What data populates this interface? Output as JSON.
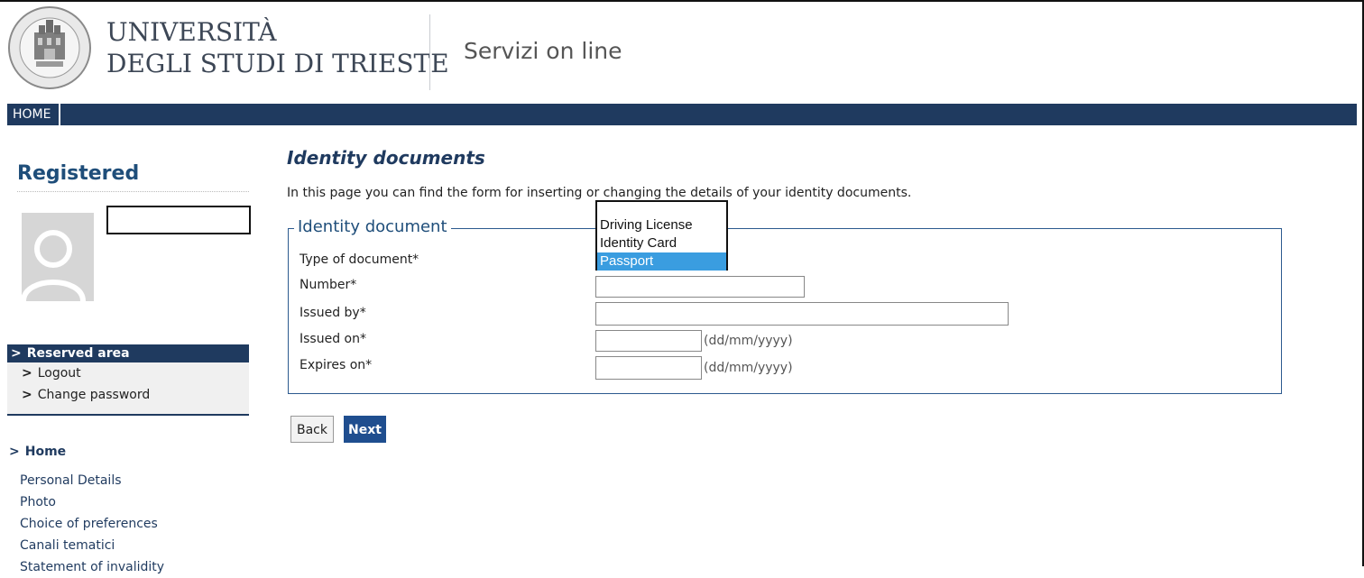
{
  "header": {
    "uni_line1": "UNIVERSITÀ",
    "uni_line2": "DEGLI STUDI DI TRIESTE",
    "services": "Servizi on line"
  },
  "nav": {
    "home": "HOME"
  },
  "sidebar": {
    "title": "Registered",
    "reserved_area": {
      "title": "Reserved area",
      "items": [
        "Logout",
        "Change password"
      ]
    },
    "home": "Home",
    "links": [
      "Personal Details",
      "Photo",
      "Choice of preferences",
      "Canali tematici",
      "Statement of invalidity"
    ]
  },
  "main": {
    "title": "Identity documents",
    "intro": "In this page you can find the form for inserting or changing the details of your identity documents.",
    "fieldset_legend": "Identity document",
    "fields": {
      "type_label": "Type of document*",
      "number_label": "Number*",
      "issued_by_label": "Issued by*",
      "issued_on_label": "Issued on*",
      "expires_on_label": "Expires on*",
      "date_format": "(dd/mm/yyyy)"
    },
    "dropdown_options": [
      "Driving License",
      "Identity Card",
      "Passport"
    ],
    "dropdown_selected": "Passport",
    "buttons": {
      "back": "Back",
      "next": "Next"
    }
  },
  "colors": {
    "navy": "#1f3a5f",
    "heading_blue": "#1f4e7a",
    "next_button": "#1f4e8f",
    "selected_option": "#3a9de0"
  }
}
